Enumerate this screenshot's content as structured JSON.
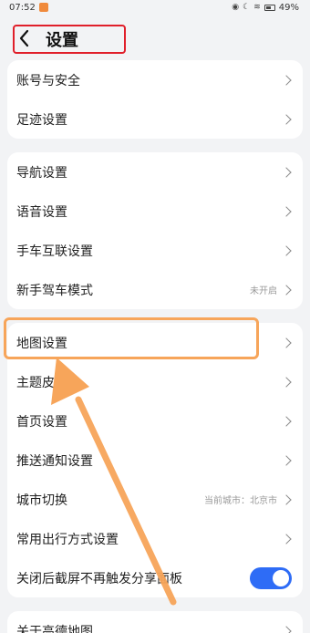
{
  "status_bar": {
    "time": "07:52",
    "battery": "49%"
  },
  "header": {
    "title": "设置"
  },
  "groups": [
    {
      "items": [
        {
          "label": "账号与安全"
        },
        {
          "label": "足迹设置"
        }
      ]
    },
    {
      "items": [
        {
          "label": "导航设置"
        },
        {
          "label": "语音设置"
        },
        {
          "label": "手车互联设置"
        },
        {
          "label": "新手驾车模式",
          "value": "未开启"
        }
      ]
    },
    {
      "items": [
        {
          "label": "地图设置"
        },
        {
          "label": "主题皮肤"
        },
        {
          "label": "首页设置"
        },
        {
          "label": "推送通知设置"
        },
        {
          "label": "城市切换",
          "value": "当前城市：北京市"
        },
        {
          "label": "常用出行方式设置"
        },
        {
          "label": "关闭后截屏不再触发分享面板",
          "toggle": true
        }
      ]
    },
    {
      "items": [
        {
          "label": "关于高德地图"
        }
      ]
    }
  ],
  "colors": {
    "accent": "#2e6cf6",
    "highlight": "#f7a55a",
    "title_box": "#e01f2a"
  }
}
